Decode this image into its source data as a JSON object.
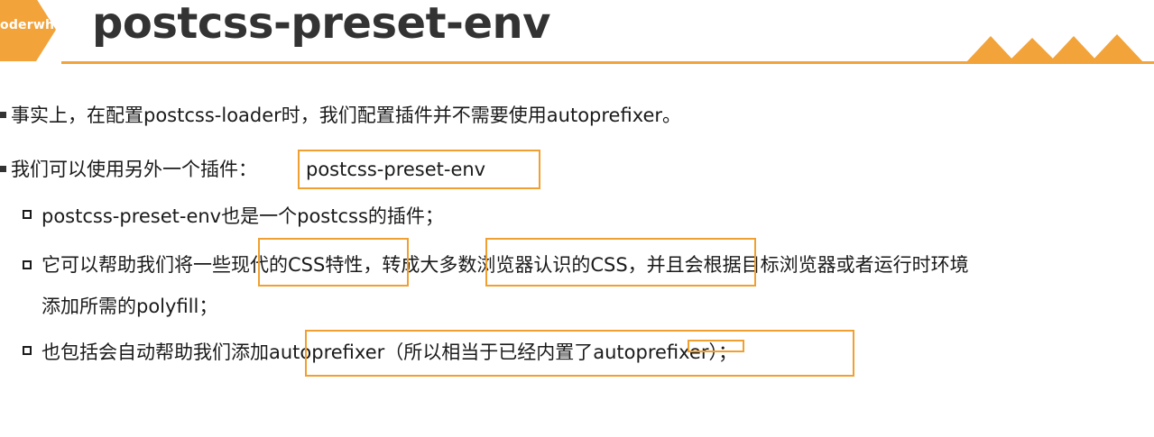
{
  "header": {
    "logo_text": "oderwhy",
    "title": "postcss-preset-env"
  },
  "colors": {
    "accent": "#f0a030",
    "text": "#1a1a1a",
    "title": "#333333"
  },
  "content": {
    "bullet1": "事实上，在配置postcss-loader时，我们配置插件并不需要使用autoprefixer。",
    "bullet2_lead": "我们可以使用另外一个插件：",
    "bullet2_plugin": "postcss-preset-env",
    "sub1": "postcss-preset-env也是一个postcss的插件；",
    "sub2_line1": "它可以帮助我们将一些现代的CSS特性，转成大多数浏览器认识的CSS，并且会根据目标浏览器或者运行时环境",
    "sub2_line2": "添加所需的polyfill；",
    "sub3": "也包括会自动帮助我们添加autoprefixer（所以相当于已经内置了autoprefixer）；"
  }
}
